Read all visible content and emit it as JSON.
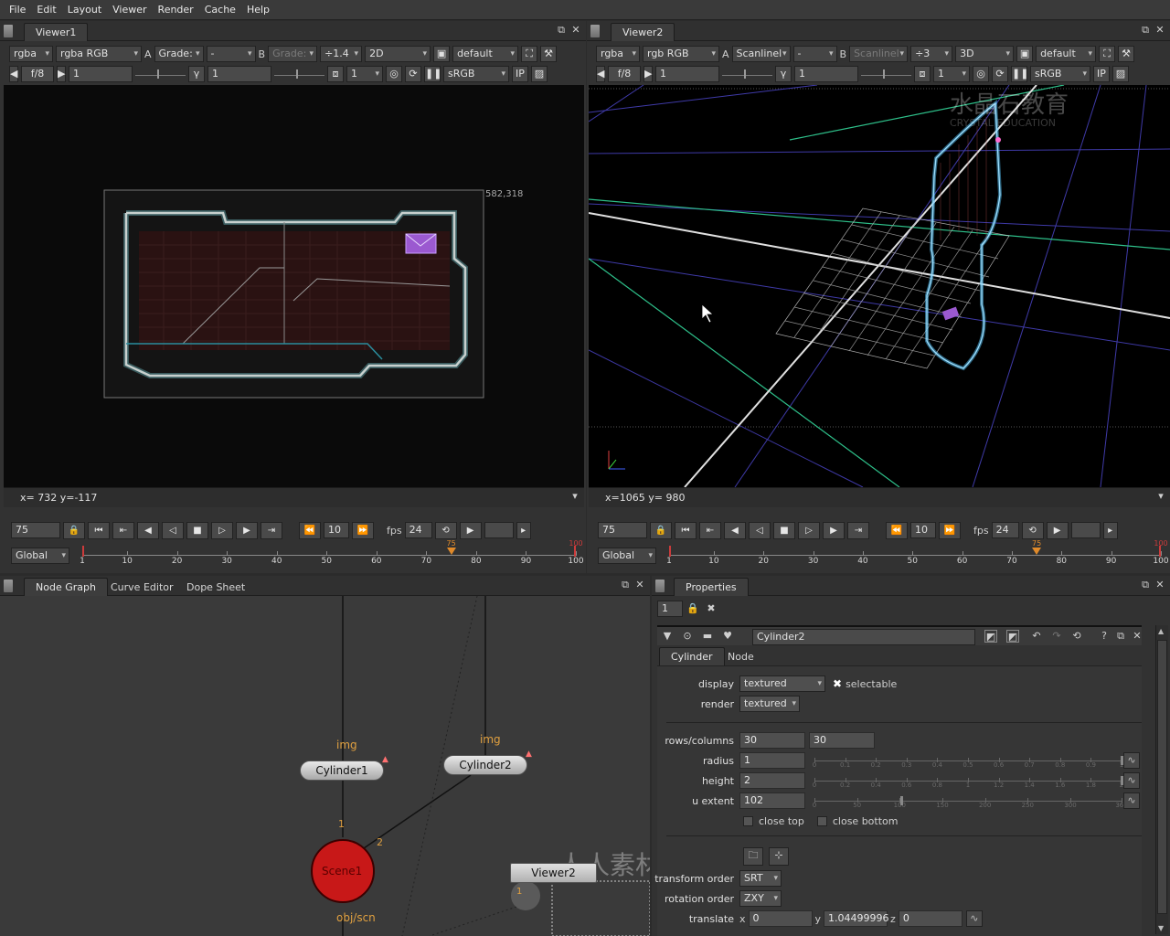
{
  "menu": [
    "File",
    "Edit",
    "Layout",
    "Viewer",
    "Render",
    "Cache",
    "Help"
  ],
  "viewer1": {
    "tab": "Viewer1",
    "channels": "rgba",
    "layer": "rgba",
    "rgb": "RGB",
    "a_label": "A",
    "a_input": "Grade:",
    "a_op": "-",
    "b_label": "B",
    "b_input": "Grade:",
    "zoom": "÷1.4",
    "mode": "2D",
    "lut": "default",
    "fstop": "f/8",
    "gain": "1",
    "gamma_label": "γ",
    "gamma": "1",
    "proxy": "1",
    "colorspace": "sRGB",
    "ip": "IP",
    "format_size": "582,318",
    "status": "x= 732 y=-117"
  },
  "viewer2": {
    "tab": "Viewer2",
    "channels": "rgba",
    "layer": "rgb",
    "rgb": "RGB",
    "a_label": "A",
    "a_input": "Scanlinel",
    "a_op": "-",
    "b_label": "B",
    "b_input": "Scanlinel",
    "zoom": "÷3",
    "mode": "3D",
    "lut": "default",
    "fstop": "f/8",
    "gain": "1",
    "gamma_label": "γ",
    "gamma": "1",
    "proxy": "1",
    "colorspace": "sRGB",
    "ip": "IP",
    "watermark": "水晶石教育",
    "watermark_sub": "CRYSTAL EDUCATION",
    "status": "x=1065 y= 980"
  },
  "timeline1": {
    "frame": "75",
    "step": "10",
    "fps_label": "fps",
    "fps": "24",
    "scope": "Global",
    "ticks": [
      "1",
      "10",
      "20",
      "30",
      "40",
      "50",
      "60",
      "70",
      "80",
      "90",
      "100"
    ],
    "current": "75",
    "end": "100"
  },
  "timeline2": {
    "frame": "75",
    "step": "10",
    "fps_label": "fps",
    "fps": "24",
    "scope": "Global",
    "ticks": [
      "1",
      "10",
      "20",
      "30",
      "40",
      "50",
      "60",
      "70",
      "80",
      "90",
      "100"
    ],
    "current": "75",
    "end": "100"
  },
  "nodegraph": {
    "tabs": [
      "Node Graph",
      "Curve Editor",
      "Dope Sheet"
    ],
    "nodes": {
      "cylinder1": "Cylinder1",
      "cylinder2": "Cylinder2",
      "scene1": "Scene1",
      "viewer2": "Viewer2"
    },
    "labels": {
      "img1": "img",
      "img2": "img",
      "objscn": "obj/scn",
      "in1": "1",
      "in2": "2",
      "in_v": "1"
    },
    "watermark": "人人素材"
  },
  "properties": {
    "tab": "Properties",
    "max_panels": "1",
    "node_name": "Cylinder2",
    "subtabs": [
      "Cylinder",
      "Node"
    ],
    "display_label": "display",
    "display": "textured",
    "selectable_label": "selectable",
    "render_label": "render",
    "render": "textured",
    "rows_label": "rows/columns",
    "rows": "30",
    "columns": "30",
    "radius_label": "radius",
    "radius": "1",
    "height_label": "height",
    "height": "2",
    "uext_label": "u extent",
    "uext": "102",
    "close_top": "close top",
    "close_bottom": "close bottom",
    "transform_order_label": "transform order",
    "transform_order": "SRT",
    "rotation_order_label": "rotation order",
    "rotation_order": "ZXY",
    "translate_label": "translate",
    "tx_label": "x",
    "tx": "0",
    "ty_label": "y",
    "ty": "1.04499996",
    "tz_label": "z",
    "tz": "0",
    "radius_ticks": [
      "0",
      "0.1",
      "0.2",
      "0.3",
      "0.4",
      "0.5",
      "0.6",
      "0.7",
      "0.8",
      "0.9",
      "1"
    ],
    "height_ticks": [
      "0",
      "0.2",
      "0.4",
      "0.6",
      "0.8",
      "1",
      "1.2",
      "1.4",
      "1.6",
      "1.8",
      "2"
    ],
    "uext_ticks": [
      "0",
      "50",
      "100",
      "150",
      "200",
      "250",
      "300",
      "360"
    ]
  },
  "colors": {
    "accent_orange": "#e08a2a",
    "scene_red": "#c81818",
    "viewer_bg": "#000000",
    "panel_bg": "#323232"
  }
}
